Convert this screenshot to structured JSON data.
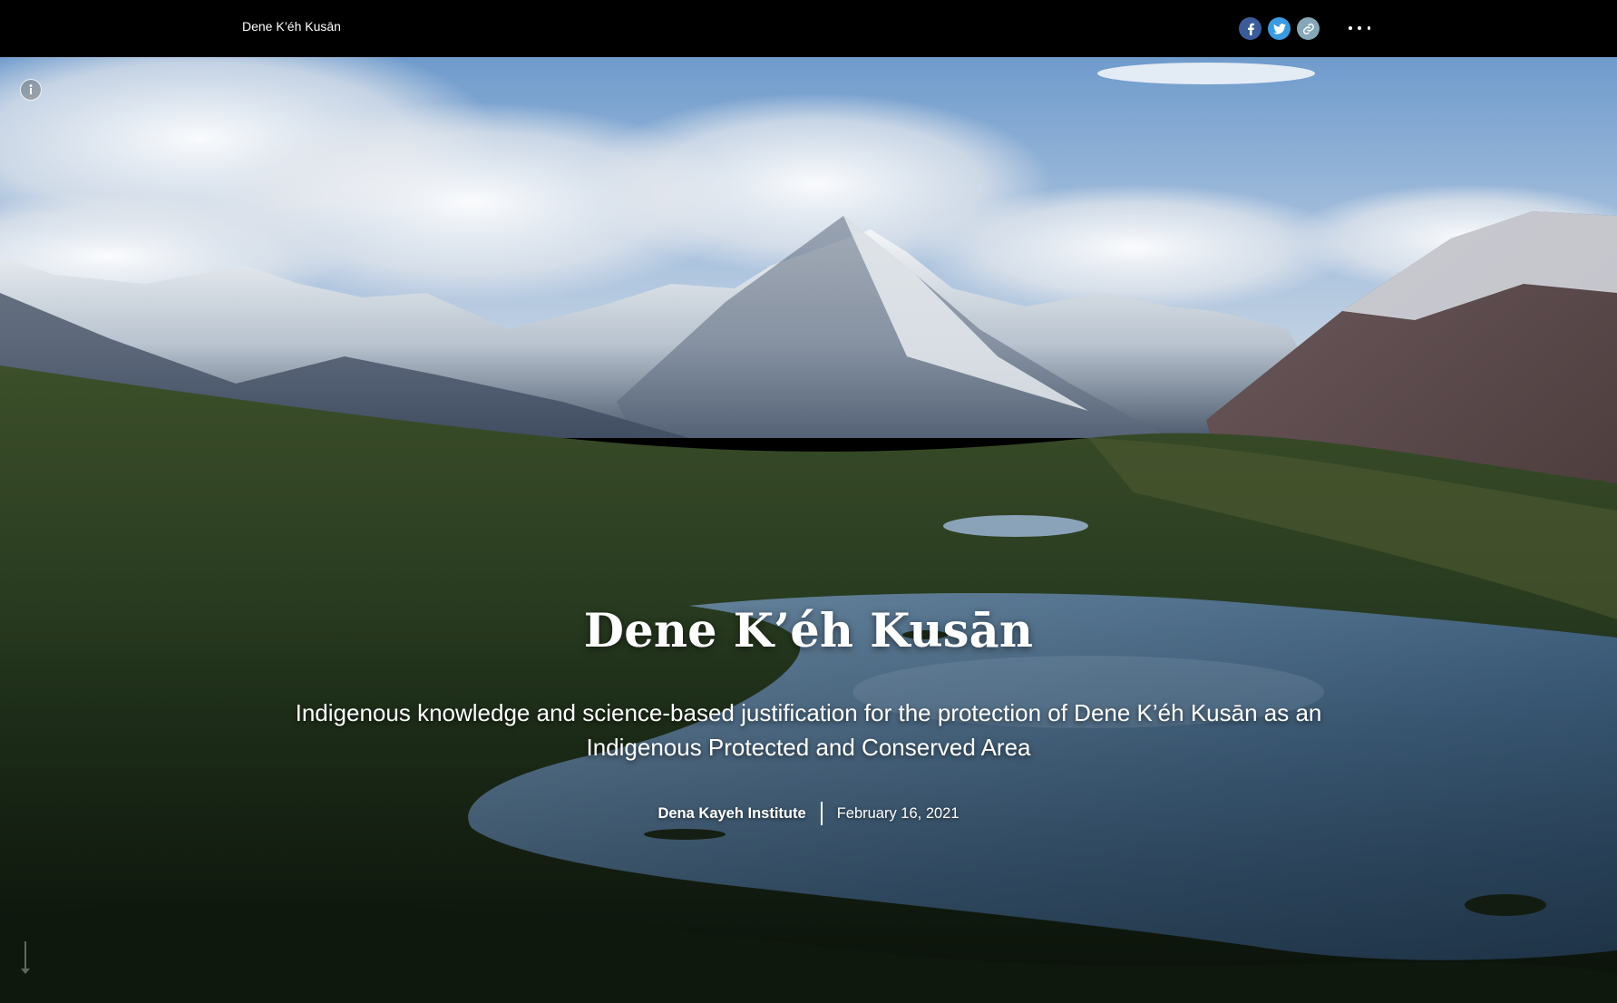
{
  "header": {
    "site_title": "Dene K’éh Kusān",
    "share_icons": [
      "facebook-icon",
      "twitter-icon",
      "link-icon"
    ],
    "more_icon": "more-horizontal-icon"
  },
  "hero": {
    "info_icon": "info-icon",
    "title": "Dene K’éh Kusān",
    "subtitle": "Indigenous knowledge and science-based justification for the protection of Dene K’éh Kusān as an Indigenous Protected and Conserved Area",
    "author": "Dena Kayeh Institute",
    "date": "February 16, 2021",
    "scroll_icon": "scroll-down-icon"
  },
  "colors": {
    "topbar_bg": "#000000",
    "facebook": "#3b5c99",
    "twitter": "#3a9be0",
    "link": "#86a7b8",
    "sky": "#7fa8d4",
    "forest": "#24361f",
    "lake": "#4a6a86"
  }
}
